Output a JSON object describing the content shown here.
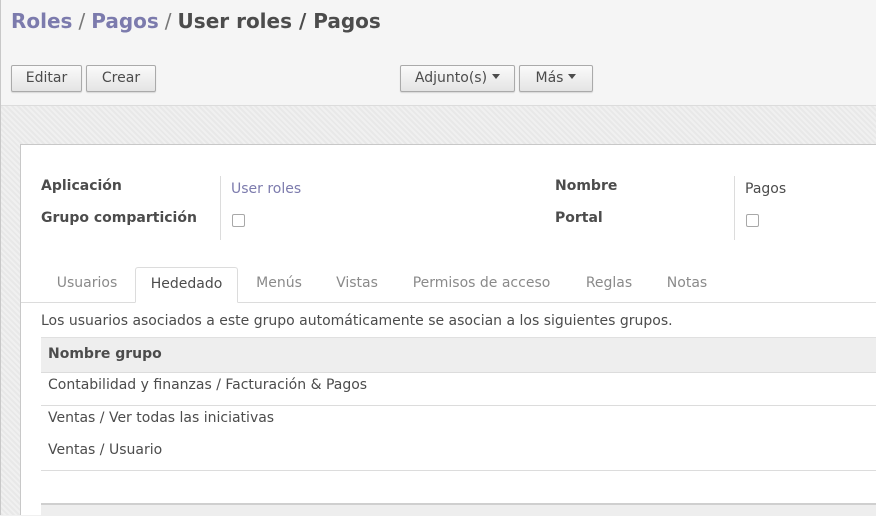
{
  "breadcrumb": {
    "items": [
      "Roles",
      "Pagos"
    ],
    "current": "User roles / Pagos",
    "separator": "/"
  },
  "toolbar": {
    "edit_label": "Editar",
    "create_label": "Crear",
    "attachments_label": "Adjunto(s)",
    "more_label": "Más"
  },
  "form": {
    "application_label": "Aplicación",
    "application_value": "User roles",
    "share_group_label": "Grupo compartición",
    "name_label": "Nombre",
    "name_value": "Pagos",
    "portal_label": "Portal"
  },
  "tabs": [
    {
      "label": "Usuarios",
      "active": false
    },
    {
      "label": "Hededado",
      "active": true
    },
    {
      "label": "Menús",
      "active": false
    },
    {
      "label": "Vistas",
      "active": false
    },
    {
      "label": "Permisos de acceso",
      "active": false
    },
    {
      "label": "Reglas",
      "active": false
    },
    {
      "label": "Notas",
      "active": false
    }
  ],
  "inherited": {
    "description": "Los usuarios asociados a este grupo automáticamente se asocian a los siguientes grupos.",
    "column_header": "Nombre grupo",
    "rows": [
      "Contabilidad y finanzas / Facturación & Pagos",
      "Ventas / Ver todas las iniciativas",
      "Ventas / Usuario"
    ]
  },
  "colors": {
    "link": "#7c7bad",
    "text": "#4c4c4c"
  }
}
